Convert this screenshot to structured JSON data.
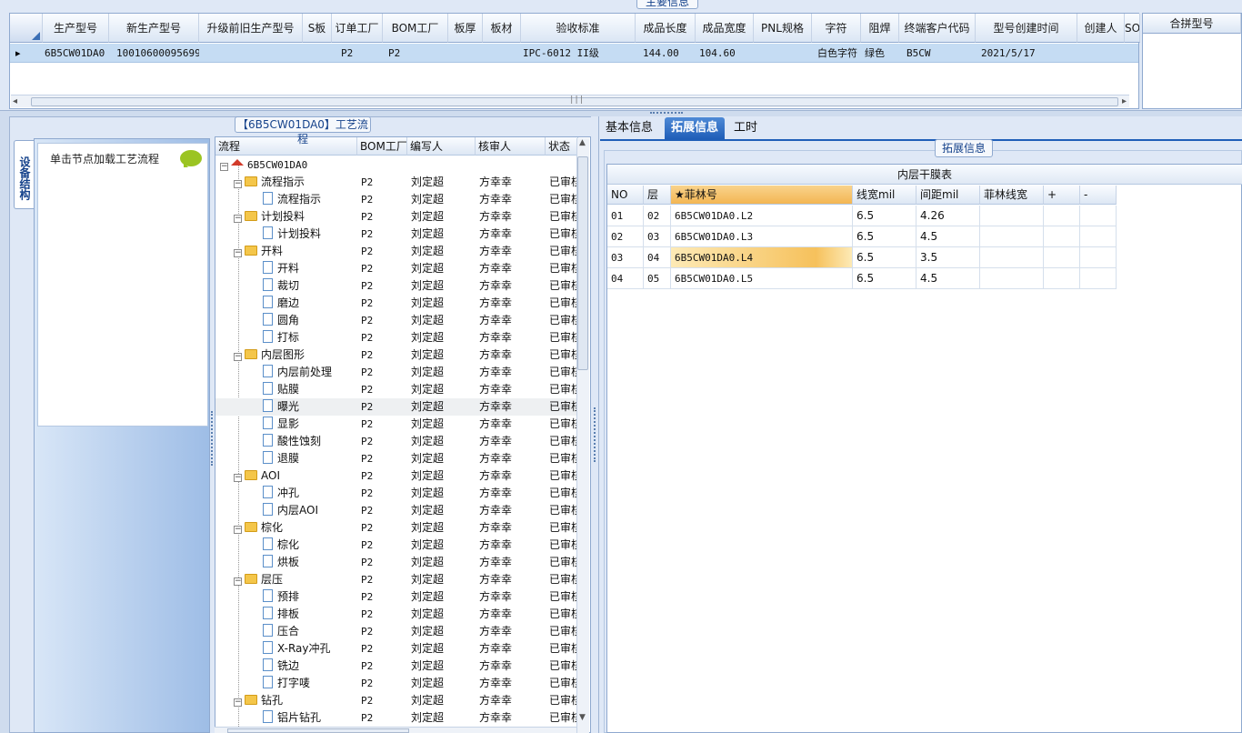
{
  "top": {
    "title": "主要信息",
    "columns": [
      "生产型号",
      "新生产型号",
      "升级前旧生产型号",
      "S板",
      "订单工厂",
      "BOM工厂",
      "板厚",
      "板材",
      "验收标准",
      "成品长度",
      "成品宽度",
      "PNL规格",
      "字符",
      "阻焊",
      "终端客户代码",
      "型号创建时间",
      "创建人",
      "SO"
    ],
    "row": {
      "生产型号": "6B5CW01DA0",
      "新生产型号": "10010600095699",
      "升级前旧生产型号": "",
      "S板": "",
      "订单工厂": "P2",
      "BOM工厂": "P2",
      "板厚": "",
      "板材": "",
      "验收标准": "IPC-6012 II级",
      "成品长度": "144.00",
      "成品宽度": "104.60",
      "PNL规格": "",
      "字符": "白色字符",
      "阻焊": "绿色",
      "终端客户代码": "B5CW",
      "型号创建时间": "2021/5/17",
      "创建人": "",
      "SO": ""
    },
    "merge_header": "合拼型号",
    "row_marker": "▸",
    "scroll_mark": "|||"
  },
  "left": {
    "vertical_tab": "设备结构",
    "node_hint": "单击节点加载工艺流程",
    "tree_title": "【6B5CW01DA0】工艺流程",
    "tree_columns": [
      "流程",
      "BOM工厂",
      "编写人",
      "核审人",
      "状态"
    ],
    "root": "6B5CW01DA0",
    "rows": [
      {
        "kind": "folder",
        "name": "流程指示",
        "bom": "P2",
        "writer": "刘定超",
        "reviewer": "方幸幸",
        "status": "已审核"
      },
      {
        "kind": "doc",
        "name": "流程指示",
        "bom": "P2",
        "writer": "刘定超",
        "reviewer": "方幸幸",
        "status": "已审核"
      },
      {
        "kind": "folder",
        "name": "计划投料",
        "bom": "P2",
        "writer": "刘定超",
        "reviewer": "方幸幸",
        "status": "已审核"
      },
      {
        "kind": "doc",
        "name": "计划投料",
        "bom": "P2",
        "writer": "刘定超",
        "reviewer": "方幸幸",
        "status": "已审核"
      },
      {
        "kind": "folder",
        "name": "开料",
        "bom": "P2",
        "writer": "刘定超",
        "reviewer": "方幸幸",
        "status": "已审核"
      },
      {
        "kind": "doc",
        "name": "开料",
        "bom": "P2",
        "writer": "刘定超",
        "reviewer": "方幸幸",
        "status": "已审核"
      },
      {
        "kind": "doc",
        "name": "裁切",
        "bom": "P2",
        "writer": "刘定超",
        "reviewer": "方幸幸",
        "status": "已审核"
      },
      {
        "kind": "doc",
        "name": "磨边",
        "bom": "P2",
        "writer": "刘定超",
        "reviewer": "方幸幸",
        "status": "已审核"
      },
      {
        "kind": "doc",
        "name": "圆角",
        "bom": "P2",
        "writer": "刘定超",
        "reviewer": "方幸幸",
        "status": "已审核"
      },
      {
        "kind": "doc",
        "name": "打标",
        "bom": "P2",
        "writer": "刘定超",
        "reviewer": "方幸幸",
        "status": "已审核"
      },
      {
        "kind": "folder",
        "name": "内层图形",
        "bom": "P2",
        "writer": "刘定超",
        "reviewer": "方幸幸",
        "status": "已审核"
      },
      {
        "kind": "doc",
        "name": "内层前处理",
        "bom": "P2",
        "writer": "刘定超",
        "reviewer": "方幸幸",
        "status": "已审核"
      },
      {
        "kind": "doc",
        "name": "贴膜",
        "bom": "P2",
        "writer": "刘定超",
        "reviewer": "方幸幸",
        "status": "已审核"
      },
      {
        "kind": "doc",
        "name": "曝光",
        "bom": "P2",
        "writer": "刘定超",
        "reviewer": "方幸幸",
        "status": "已审核",
        "selected": true
      },
      {
        "kind": "doc",
        "name": "显影",
        "bom": "P2",
        "writer": "刘定超",
        "reviewer": "方幸幸",
        "status": "已审核"
      },
      {
        "kind": "doc",
        "name": "酸性蚀刻",
        "bom": "P2",
        "writer": "刘定超",
        "reviewer": "方幸幸",
        "status": "已审核"
      },
      {
        "kind": "doc",
        "name": "退膜",
        "bom": "P2",
        "writer": "刘定超",
        "reviewer": "方幸幸",
        "status": "已审核"
      },
      {
        "kind": "folder",
        "name": "AOI",
        "bom": "P2",
        "writer": "刘定超",
        "reviewer": "方幸幸",
        "status": "已审核"
      },
      {
        "kind": "doc",
        "name": "冲孔",
        "bom": "P2",
        "writer": "刘定超",
        "reviewer": "方幸幸",
        "status": "已审核"
      },
      {
        "kind": "doc",
        "name": "内层AOI",
        "bom": "P2",
        "writer": "刘定超",
        "reviewer": "方幸幸",
        "status": "已审核"
      },
      {
        "kind": "folder",
        "name": "棕化",
        "bom": "P2",
        "writer": "刘定超",
        "reviewer": "方幸幸",
        "status": "已审核"
      },
      {
        "kind": "doc",
        "name": "棕化",
        "bom": "P2",
        "writer": "刘定超",
        "reviewer": "方幸幸",
        "status": "已审核"
      },
      {
        "kind": "doc",
        "name": "烘板",
        "bom": "P2",
        "writer": "刘定超",
        "reviewer": "方幸幸",
        "status": "已审核"
      },
      {
        "kind": "folder",
        "name": "层压",
        "bom": "P2",
        "writer": "刘定超",
        "reviewer": "方幸幸",
        "status": "已审核"
      },
      {
        "kind": "doc",
        "name": "预排",
        "bom": "P2",
        "writer": "刘定超",
        "reviewer": "方幸幸",
        "status": "已审核"
      },
      {
        "kind": "doc",
        "name": "排板",
        "bom": "P2",
        "writer": "刘定超",
        "reviewer": "方幸幸",
        "status": "已审核"
      },
      {
        "kind": "doc",
        "name": "压合",
        "bom": "P2",
        "writer": "刘定超",
        "reviewer": "方幸幸",
        "status": "已审核"
      },
      {
        "kind": "doc",
        "name": "X-Ray冲孔",
        "bom": "P2",
        "writer": "刘定超",
        "reviewer": "方幸幸",
        "status": "已审核"
      },
      {
        "kind": "doc",
        "name": "铣边",
        "bom": "P2",
        "writer": "刘定超",
        "reviewer": "方幸幸",
        "status": "已审核"
      },
      {
        "kind": "doc",
        "name": "打字唛",
        "bom": "P2",
        "writer": "刘定超",
        "reviewer": "方幸幸",
        "status": "已审核"
      },
      {
        "kind": "folder",
        "name": "钻孔",
        "bom": "P2",
        "writer": "刘定超",
        "reviewer": "方幸幸",
        "status": "已审核"
      },
      {
        "kind": "doc",
        "name": "铝片钻孔",
        "bom": "P2",
        "writer": "刘定超",
        "reviewer": "方幸幸",
        "status": "已审核"
      }
    ]
  },
  "right": {
    "tabs": [
      "基本信息",
      "拓展信息",
      "工时"
    ],
    "active_tab": "拓展信息",
    "group_title": "拓展信息",
    "table_caption": "内层干膜表",
    "columns": [
      "NO",
      "层",
      "★菲林号",
      "线宽mil",
      "间距mil",
      "菲林线宽",
      "+",
      "-"
    ],
    "rows": [
      {
        "no": "01",
        "layer": "02",
        "film": "6B5CW01DA0.L2",
        "width": "6.5",
        "spacing": "4.26",
        "film_width": ""
      },
      {
        "no": "02",
        "layer": "03",
        "film": "6B5CW01DA0.L3",
        "width": "6.5",
        "spacing": "4.5",
        "film_width": ""
      },
      {
        "no": "03",
        "layer": "04",
        "film": "6B5CW01DA0.L4",
        "width": "6.5",
        "spacing": "3.5",
        "film_width": ""
      },
      {
        "no": "04",
        "layer": "05",
        "film": "6B5CW01DA0.L5",
        "width": "6.5",
        "spacing": "4.5",
        "film_width": ""
      }
    ],
    "highlight_row": 2
  },
  "colors": {
    "accent": "#1f5eb8",
    "selected_row": "#c5dcf3",
    "highlight": "#f6c15c",
    "folder": "#f4c64a"
  }
}
